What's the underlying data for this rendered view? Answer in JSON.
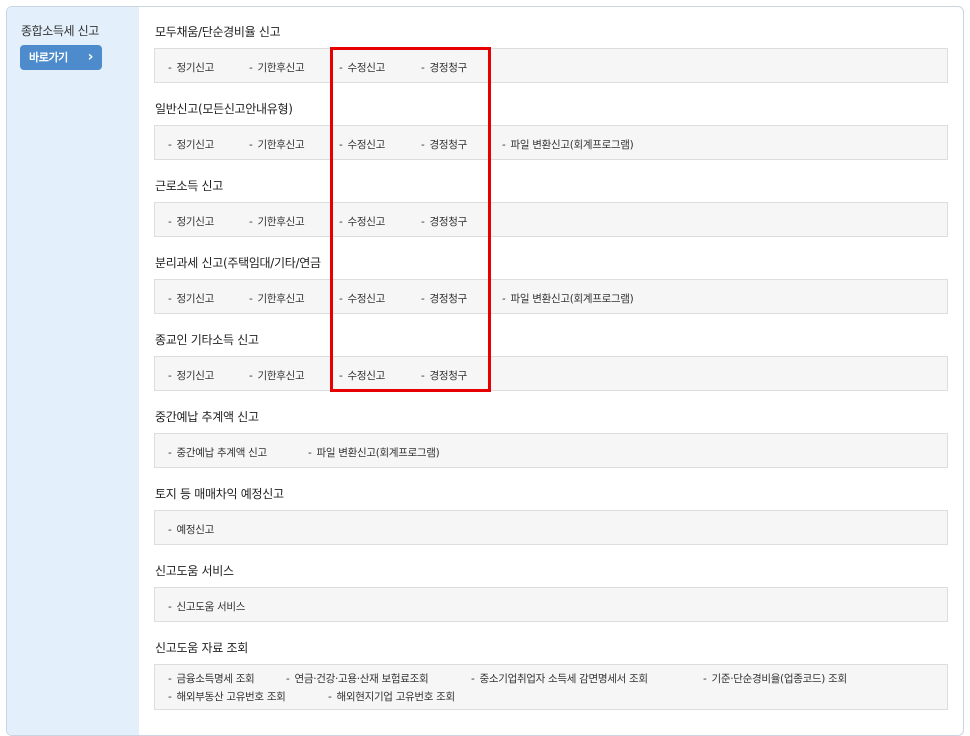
{
  "sidebar": {
    "title": "종합소득세 신고",
    "go_button": "바로가기",
    "go_icon": "chevron-right-icon"
  },
  "sections": [
    {
      "title": "모두채움/단순경비율 신고",
      "links": [
        "정기신고",
        "기한후신고",
        "수정신고",
        "경정청구"
      ]
    },
    {
      "title": "일반신고(모든신고안내유형)",
      "links": [
        "정기신고",
        "기한후신고",
        "수정신고",
        "경정청구",
        "파일 변환신고(회계프로그램)"
      ]
    },
    {
      "title": "근로소득 신고",
      "links": [
        "정기신고",
        "기한후신고",
        "수정신고",
        "경정청구"
      ]
    },
    {
      "title": "분리과세 신고(주택임대/기타/연금",
      "links": [
        "정기신고",
        "기한후신고",
        "수정신고",
        "경정청구",
        "파일 변환신고(회계프로그램)"
      ]
    },
    {
      "title": "종교인 기타소득 신고",
      "links": [
        "정기신고",
        "기한후신고",
        "수정신고",
        "경정청구"
      ]
    },
    {
      "title": "중간예납 추계액 신고",
      "links": [
        "중간예납 추계액 신고",
        "파일 변환신고(회계프로그램)"
      ]
    },
    {
      "title": "토지 등 매매차익 예정신고",
      "links": [
        "예정신고"
      ]
    },
    {
      "title": "신고도움 서비스",
      "links": [
        "신고도움 서비스"
      ]
    },
    {
      "title": "신고도움 자료 조회",
      "links": [
        "금융소득명세 조회",
        "연금·건강·고용·산재 보험료조회",
        "중소기업취업자 소득세 감면명세서 조회",
        "기준·단순경비율(업종코드) 조회",
        "해외부동산 고유번호 조회",
        "해외현지기업 고유번호 조회"
      ]
    }
  ],
  "colors": {
    "sidebar_bg": "#e3f0fb",
    "button_bg": "#4d8bcd",
    "highlight": "#e60000"
  }
}
